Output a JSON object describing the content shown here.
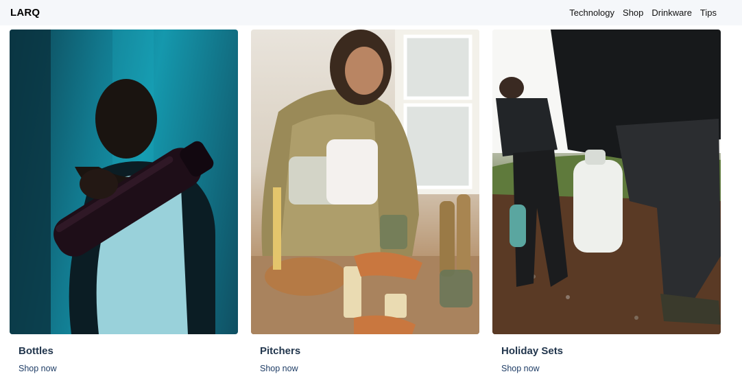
{
  "header": {
    "brand": "LARQ",
    "nav": [
      "Technology",
      "Shop",
      "Drinkware",
      "Tips"
    ]
  },
  "cards": [
    {
      "title": "Bottles",
      "cta": "Shop now"
    },
    {
      "title": "Pitchers",
      "cta": "Shop now"
    },
    {
      "title": "Holiday Sets",
      "cta": "Shop now"
    }
  ]
}
